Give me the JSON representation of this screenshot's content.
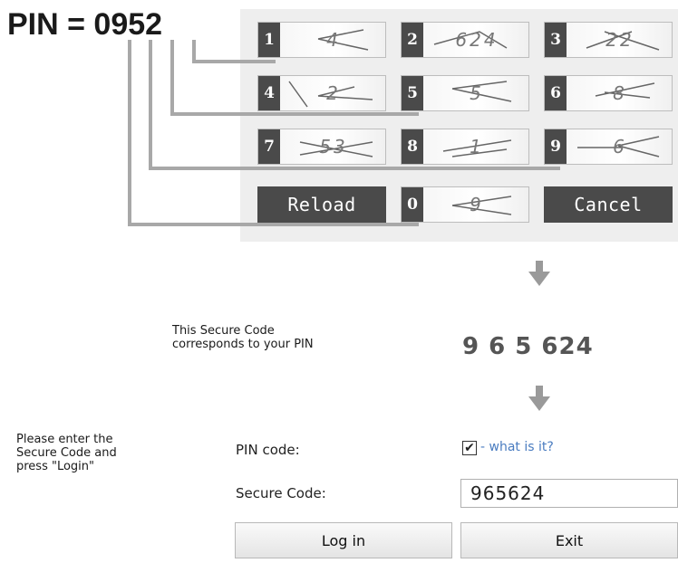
{
  "title": "PIN = 0952",
  "keypad": {
    "keys": [
      {
        "num": "1",
        "captcha": "4"
      },
      {
        "num": "2",
        "captcha": "624"
      },
      {
        "num": "3",
        "captcha": "22"
      },
      {
        "num": "4",
        "captcha": "2"
      },
      {
        "num": "5",
        "captcha": "5"
      },
      {
        "num": "6",
        "captcha": "8"
      },
      {
        "num": "7",
        "captcha": "53"
      },
      {
        "num": "8",
        "captcha": "1"
      },
      {
        "num": "9",
        "captcha": "6"
      },
      {
        "num": "0",
        "captcha": "9"
      }
    ],
    "reload_label": "Reload",
    "cancel_label": "Cancel"
  },
  "secure_code": {
    "note": [
      "This Secure Code",
      "corresponds to your PIN"
    ],
    "value": "9 6 5 624"
  },
  "instructions": [
    "Please enter the",
    "Secure Code and",
    "press \"Login\""
  ],
  "form": {
    "pin_code_label": "PIN code:",
    "pin_checked": true,
    "what_is_it": "- what is it?",
    "secure_code_label": "Secure Code:",
    "secure_code_value": "965624",
    "login_label": "Log in",
    "exit_label": "Exit"
  },
  "colors": {
    "key_dark": "#4a4a4a",
    "pad_bg": "#eeeeee",
    "connector": "#a8a8a8",
    "link": "#4a7cc0",
    "arrow": "#9a9a9a"
  }
}
